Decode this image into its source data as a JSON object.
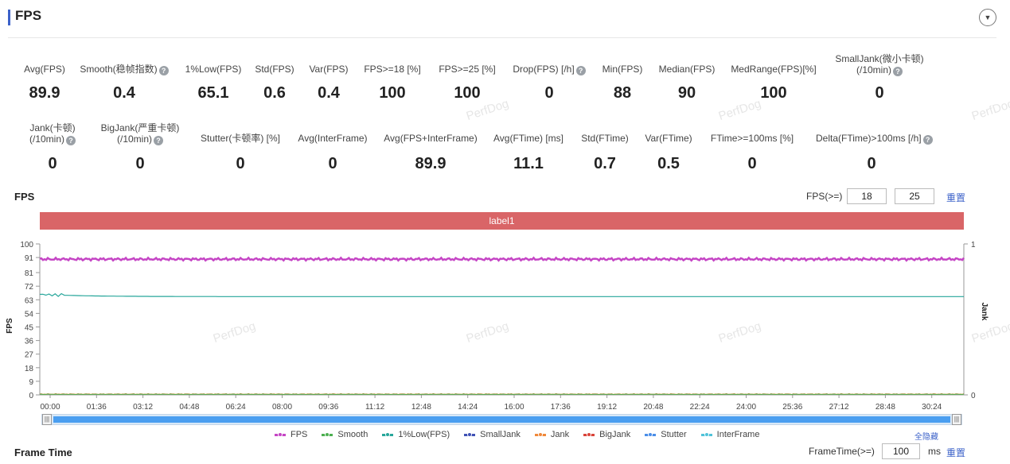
{
  "header": {
    "title": "FPS",
    "collapse_icon": "chevron-down-icon"
  },
  "metrics_row1": [
    {
      "label": "Avg(FPS)",
      "value": "89.9",
      "help": false
    },
    {
      "label": "Smooth(稳帧指数)",
      "value": "0.4",
      "help": true
    },
    {
      "label": "1%Low(FPS)",
      "value": "65.1",
      "help": false
    },
    {
      "label": "Std(FPS)",
      "value": "0.6",
      "help": false
    },
    {
      "label": "Var(FPS)",
      "value": "0.4",
      "help": false
    },
    {
      "label": "FPS>=18 [%]",
      "value": "100",
      "help": false
    },
    {
      "label": "FPS>=25 [%]",
      "value": "100",
      "help": false
    },
    {
      "label": "Drop(FPS) [/h]",
      "value": "0",
      "help": true
    },
    {
      "label": "Min(FPS)",
      "value": "88",
      "help": false
    },
    {
      "label": "Median(FPS)",
      "value": "90",
      "help": false
    },
    {
      "label": "MedRange(FPS)[%]",
      "value": "100",
      "help": false
    },
    {
      "label": "SmallJank(微小卡顿)",
      "label2": "(/10min)",
      "value": "0",
      "help": true
    }
  ],
  "metrics_row2": [
    {
      "label": "Jank(卡顿)",
      "label2": "(/10min)",
      "value": "0",
      "help": true
    },
    {
      "label": "BigJank(严重卡顿)",
      "label2": "(/10min)",
      "value": "0",
      "help": true
    },
    {
      "label": "Stutter(卡顿率) [%]",
      "value": "0",
      "help": false
    },
    {
      "label": "Avg(InterFrame)",
      "value": "0",
      "help": false
    },
    {
      "label": "Avg(FPS+InterFrame)",
      "value": "89.9",
      "help": false
    },
    {
      "label": "Avg(FTime) [ms]",
      "value": "11.1",
      "help": false
    },
    {
      "label": "Std(FTime)",
      "value": "0.7",
      "help": false
    },
    {
      "label": "Var(FTime)",
      "value": "0.5",
      "help": false
    },
    {
      "label": "FTime>=100ms [%]",
      "value": "0",
      "help": false
    },
    {
      "label": "Delta(FTime)>100ms [/h]",
      "value": "0",
      "help": true
    }
  ],
  "fps_section": {
    "title": "FPS",
    "threshold_label": "FPS(>=)",
    "threshold_1": "18",
    "threshold_2": "25",
    "reset_label": "重置",
    "label_bar": "label1"
  },
  "watermark": "PerfDog",
  "chart_data": {
    "type": "line",
    "ylabel": "FPS",
    "y2label": "Jank",
    "y_ticks": [
      "100",
      "91",
      "81",
      "72",
      "63",
      "54",
      "45",
      "36",
      "27",
      "18",
      "9",
      "0"
    ],
    "y2_ticks": [
      "1",
      "0"
    ],
    "ylim": [
      0,
      100
    ],
    "x_ticks": [
      "00:00",
      "01:36",
      "03:12",
      "04:48",
      "06:24",
      "08:00",
      "09:36",
      "11:12",
      "12:48",
      "14:24",
      "16:00",
      "17:36",
      "19:12",
      "20:48",
      "22:24",
      "24:00",
      "25:36",
      "27:12",
      "28:48",
      "30:24"
    ],
    "series": [
      {
        "name": "FPS",
        "color": "#c545c5",
        "approx_value": 90
      },
      {
        "name": "Smooth",
        "color": "#4caf50",
        "approx_value": 0.4
      },
      {
        "name": "1%Low(FPS)",
        "color": "#26a69a",
        "approx_value": 65
      },
      {
        "name": "SmallJank",
        "color": "#3f51b5",
        "approx_value": 0
      },
      {
        "name": "Jank",
        "color": "#f0883a",
        "approx_value": 0
      },
      {
        "name": "BigJank",
        "color": "#d9443a",
        "approx_value": 0
      },
      {
        "name": "Stutter",
        "color": "#4a8ee8",
        "approx_value": 0
      },
      {
        "name": "InterFrame",
        "color": "#4fc3d9",
        "approx_value": 0
      }
    ],
    "legend_toggle": "全隐藏"
  },
  "frametime_section": {
    "title": "Frame Time",
    "threshold_label": "FrameTime(>=)",
    "threshold_value": "100",
    "unit": "ms",
    "reset_label": "重置"
  }
}
